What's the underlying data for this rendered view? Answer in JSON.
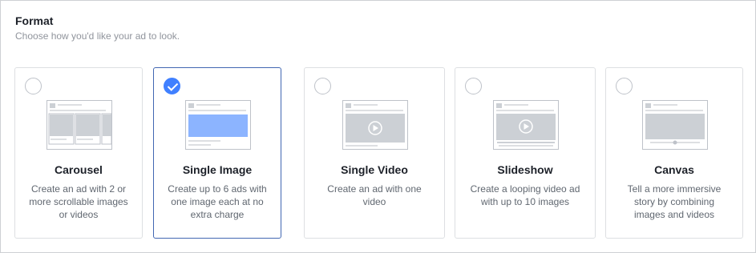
{
  "section": {
    "title": "Format",
    "subtitle": "Choose how you'd like your ad to look."
  },
  "formats": [
    {
      "label": "Carousel",
      "description": "Create an ad with 2 or more scrollable images or videos",
      "selected": false,
      "icon": "carousel-preview-icon"
    },
    {
      "label": "Single Image",
      "description": "Create up to 6 ads with one image each at no extra charge",
      "selected": true,
      "icon": "single-image-preview-icon"
    },
    {
      "label": "Single Video",
      "description": "Create an ad with one video",
      "selected": false,
      "icon": "single-video-preview-icon"
    },
    {
      "label": "Slideshow",
      "description": "Create a looping video ad with up to 10 images",
      "selected": false,
      "icon": "slideshow-preview-icon"
    },
    {
      "label": "Canvas",
      "description": "Tell a more immersive story by combining images and videos",
      "selected": false,
      "icon": "canvas-preview-icon"
    }
  ],
  "colors": {
    "selected_border": "#4267b2",
    "checkmark_fill": "#4080ff",
    "image_highlight": "#8cb4ff",
    "placeholder_gray": "#bec2c9"
  }
}
